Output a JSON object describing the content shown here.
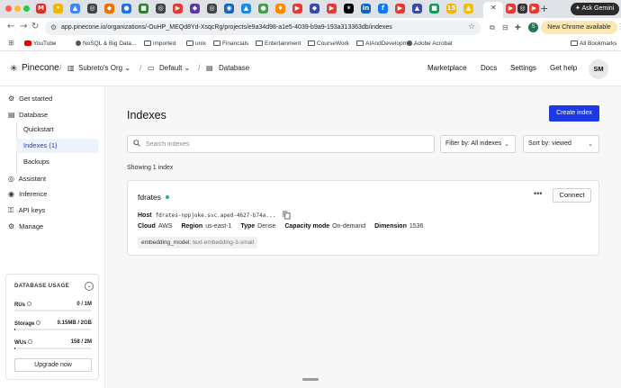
{
  "browser": {
    "tab_favicons": [
      {
        "icon": "mail-icon",
        "color": "#d93025",
        "glyph": "M"
      },
      {
        "icon": "site-icon",
        "color": "#f4b400",
        "glyph": "•"
      },
      {
        "icon": "doc-icon",
        "color": "#4285f4",
        "glyph": "▲"
      },
      {
        "icon": "site-icon",
        "color": "#444444",
        "glyph": "◎"
      },
      {
        "icon": "site-icon",
        "color": "#e8710a",
        "glyph": "◆"
      },
      {
        "icon": "site-icon",
        "color": "#1a73e8",
        "glyph": "●"
      },
      {
        "icon": "site-icon",
        "color": "#2e7d32",
        "glyph": "■"
      },
      {
        "icon": "site-icon",
        "color": "#444444",
        "glyph": "◎"
      },
      {
        "icon": "site-icon",
        "color": "#e53935",
        "glyph": "▶"
      },
      {
        "icon": "site-icon",
        "color": "#5e35b1",
        "glyph": "◆"
      },
      {
        "icon": "site-icon",
        "color": "#444444",
        "glyph": "◎"
      },
      {
        "icon": "site-icon",
        "color": "#1565c0",
        "glyph": "◉"
      },
      {
        "icon": "site-icon",
        "color": "#1e88e5",
        "glyph": "▲"
      },
      {
        "icon": "site-icon",
        "color": "#43a047",
        "glyph": "●"
      },
      {
        "icon": "site-icon",
        "color": "#fb8c00",
        "glyph": "♦"
      },
      {
        "icon": "site-icon",
        "color": "#e53935",
        "glyph": "▶"
      },
      {
        "icon": "site-icon",
        "color": "#3949ab",
        "glyph": "◆"
      },
      {
        "icon": "site-icon",
        "color": "#e53935",
        "glyph": "▶"
      },
      {
        "icon": "site-icon",
        "color": "#000000",
        "glyph": "✶"
      },
      {
        "icon": "site-icon",
        "color": "#0a66c2",
        "glyph": "in"
      },
      {
        "icon": "site-icon",
        "color": "#1877f2",
        "glyph": "f"
      },
      {
        "icon": "site-icon",
        "color": "#e53935",
        "glyph": "▶"
      },
      {
        "icon": "site-icon",
        "color": "#3949ab",
        "glyph": "▲"
      },
      {
        "icon": "site-icon",
        "color": "#0f9d58",
        "glyph": "■"
      },
      {
        "icon": "site-icon",
        "color": "#f4b400",
        "glyph": "15"
      },
      {
        "icon": "site-icon",
        "color": "#fbbc04",
        "glyph": "▲"
      }
    ],
    "after_tab_favicons": [
      {
        "icon": "site-icon",
        "color": "#e53935",
        "glyph": "▶"
      },
      {
        "icon": "site-icon",
        "color": "#333333",
        "glyph": "◎"
      },
      {
        "icon": "site-icon",
        "color": "#e53935",
        "glyph": "▶"
      }
    ],
    "gemini_label": "Ask Gemini",
    "url": "app.pinecone.io/organizations/-OuHP_MEQd8Yd-XsqcRg/projects/e9a34d98-a1e5-4039-b9a9-193a313363db/indexes",
    "profile_initial": "S",
    "update_label": "New Chrome available",
    "bookmarks": [
      {
        "label": "YouTube",
        "icon": "youtube-icon"
      },
      {
        "label": "NoSQL & Big Data...",
        "icon": "site-icon"
      },
      {
        "label": "imported",
        "icon": "folder-icon"
      },
      {
        "label": "unix",
        "icon": "folder-icon"
      },
      {
        "label": "Financials",
        "icon": "folder-icon"
      },
      {
        "label": "Entertainment",
        "icon": "folder-icon"
      },
      {
        "label": "CourseWork",
        "icon": "folder-icon"
      },
      {
        "label": "AIAndDevelopme...",
        "icon": "folder-icon"
      },
      {
        "label": "Adobe Acrobat",
        "icon": "site-icon"
      }
    ],
    "all_bookmarks": "All Bookmarks"
  },
  "header": {
    "logo_text": "Pinecone",
    "org": "Subreto's Org",
    "project": "Default",
    "section": "Database",
    "nav": [
      "Marketplace",
      "Docs",
      "Settings",
      "Get help"
    ],
    "avatar_initials": "SM"
  },
  "sidebar": {
    "items": [
      {
        "label": "Get started",
        "icon": "rocket-icon"
      },
      {
        "label": "Database",
        "icon": "database-icon"
      },
      {
        "label": "Assistant",
        "icon": "assistant-icon"
      },
      {
        "label": "Inference",
        "icon": "inference-icon"
      },
      {
        "label": "API keys",
        "icon": "key-icon"
      },
      {
        "label": "Manage",
        "icon": "manage-icon"
      }
    ],
    "database_subitems": [
      "Quickstart",
      "Indexes (1)",
      "Backups"
    ],
    "active_subitem": "Indexes (1)",
    "usage": {
      "title": "DATABASE USAGE",
      "rows": [
        {
          "label": "RUs",
          "value": "0 / 1M",
          "fill": 0
        },
        {
          "label": "Storage",
          "value": "0.15MB / 2GB",
          "fill": 0.01
        },
        {
          "label": "WUs",
          "value": "158 / 2M",
          "fill": 0.01
        }
      ],
      "upgrade_label": "Upgrade now"
    }
  },
  "main": {
    "title": "Indexes",
    "create_label": "Create index",
    "search_placeholder": "Search indexes",
    "search_value": "",
    "filter_label": "Filter by: All indexes",
    "sort_label": "Sort by: viewed",
    "showing": "Showing 1 index",
    "index": {
      "name": "fdrates",
      "status_color": "#2cb36a",
      "connect_label": "Connect",
      "host_key": "Host",
      "host_value": "fdrates-nppjoke.svc.aped-4627-b74a...",
      "meta": [
        {
          "key": "Cloud",
          "value": "AWS"
        },
        {
          "key": "Region",
          "value": "us-east-1"
        },
        {
          "key": "Type",
          "value": "Dense"
        },
        {
          "key": "Capacity mode",
          "value": "On-demand"
        },
        {
          "key": "Dimension",
          "value": "1536"
        }
      ],
      "tag_key": "embedding_model:",
      "tag_value": "text-embedding-3-small"
    }
  },
  "colors": {
    "accent": "#1b3ae6",
    "active_bg": "#eef2fd",
    "main_bg": "#f7f7f8"
  }
}
